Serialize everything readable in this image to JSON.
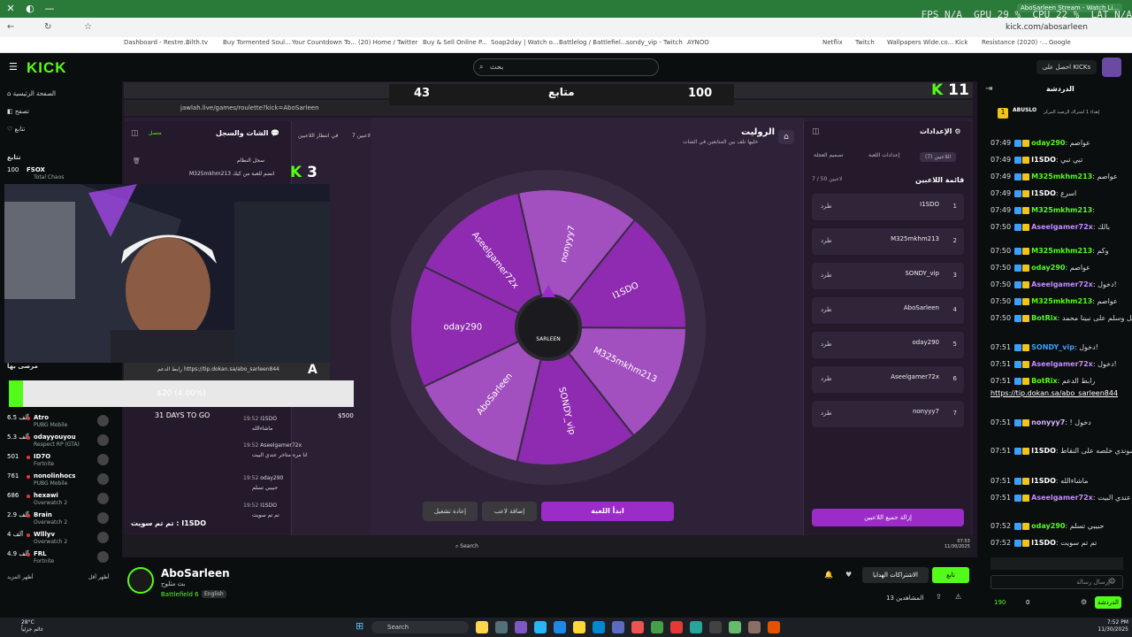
{
  "browser": {
    "url": "kick.com/abosarleen",
    "tab_title": "AboSarleen Stream - Watch Li...",
    "bookmarks": [
      "Dashboard - Restre...",
      "Bilth.tv",
      "Buy Tormented Soul...",
      "Your Countdown To...",
      "(20) Home / Twitter",
      "Buy & Sell Online P...",
      "Soap2day | Watch o...",
      "Battlelog / Battlefiel...",
      "sondy_vip - Twitch",
      "AYNOO",
      "Netflix",
      "Twitch",
      "Wallpapers Wide.co...",
      "Kick",
      "Resistance (2020) -...",
      "Google"
    ]
  },
  "osd": {
    "fps": "FPS  N/A",
    "gpu": "GPU 29 %",
    "cpu": "CPU 22 %",
    "lat": "LAT  N/A"
  },
  "kick": {
    "search_placeholder": "بحث",
    "get_kicks": "احصل على KICKs"
  },
  "sidebar": {
    "nav": [
      "الصفحة الرئيسية",
      "تصفح",
      "تتابع"
    ],
    "following_label": "تتابع",
    "recommended_label": "مرصى بها",
    "show_more": "أظهر المزيد",
    "show_less": "أظهر أقل",
    "channels": [
      {
        "name": "FSOX",
        "viewers": "100",
        "game": "Total Chaos"
      },
      {
        "name": "Atro",
        "viewers": "6.5 آلف",
        "game": "PUBG Mobile"
      },
      {
        "name": "odayyouyou",
        "viewers": "5.3 آلف",
        "game": "Respect RP (GTA)"
      },
      {
        "name": "ID7O",
        "viewers": "501",
        "game": "Fortnite"
      },
      {
        "name": "nonolinhocs",
        "viewers": "761",
        "game": "PUBG Mobile"
      },
      {
        "name": "hexawi",
        "viewers": "686",
        "game": "Overwatch 2"
      },
      {
        "name": "Brain",
        "viewers": "2.9 آلف",
        "game": "Overwatch 2"
      },
      {
        "name": "Wlllyv",
        "viewers": "4 آلف",
        "game": "Overwatch 2"
      },
      {
        "name": "FRL",
        "viewers": "4.9 آلف",
        "game": "Fortnite"
      }
    ]
  },
  "overlay": {
    "score_left": "43",
    "score_label": "متابع",
    "score_right": "100",
    "kick_count": "11",
    "k3": "3"
  },
  "game": {
    "iframe_url": "jawlah.live/games/roulette?kick=AboSarleen",
    "title": "الروليت",
    "subtitle": "خليها تلف بين المتابعين في الشات",
    "waiting": "في انتظار اللاعبين",
    "players_count": "7 لاعبين",
    "settings_title": "الإعدادات",
    "tabs": [
      "اللاعبين (7)",
      "إعدادات اللعبة",
      "تصميم العجلة"
    ],
    "list_title": "قائمة اللاعبين",
    "list_count": "7 / 50 لاعبين",
    "players": [
      {
        "n": "1",
        "name": "I1SDO"
      },
      {
        "n": "2",
        "name": "M325mkhm213"
      },
      {
        "n": "3",
        "name": "SONDY_vip"
      },
      {
        "n": "4",
        "name": "AboSarleen"
      },
      {
        "n": "5",
        "name": "oday290"
      },
      {
        "n": "6",
        "name": "Aseelgamer72x"
      },
      {
        "n": "7",
        "name": "nonyyy7"
      }
    ],
    "kick_label": "طرد",
    "wheel": [
      "Aseelgamer72x",
      "nonyyy7",
      "I1SDO",
      "M325mkhm213",
      "SONDY_vip",
      "AboSarleen",
      "oday290"
    ],
    "wheel_center": "SARLEEN",
    "start": "ابدأ اللعبة",
    "add": "إضافة لاعب",
    "reset": "إعادة تشغيل",
    "remove_all": "إزالة جميع اللاعبين",
    "chat_title": "الشات والسجل",
    "connected": "متصل",
    "system_log": "سجل النظام",
    "join_msg": "M325mkhm213 انضم للعبة من كيك",
    "time": "07:53",
    "date": "11/30/2025"
  },
  "goal": {
    "text": "$20 (4.00%)",
    "days": "31 DAYS TO GO",
    "amount": "$500"
  },
  "donate_url": "رابط الدعم https://tip.dokan.sa/abo_sarleen844",
  "cam_msgs": [
    {
      "user": "I1SDO",
      "text": "ماشاءالله",
      "time": "19:52"
    },
    {
      "user": "Aseelgamer72x",
      "text": "انا مره متاخر عندي البيت",
      "time": "19:52"
    },
    {
      "user": "oday290",
      "text": "حبيبي تسلم",
      "time": "19:52"
    },
    {
      "user": "I1SDO",
      "text": "تم تم سويت",
      "time": "19:52"
    }
  ],
  "cam_bottom": "تم تم سويت : I1SDO",
  "chat": {
    "title": "الدردشة",
    "top_user": "ABUSLO",
    "top_note": "إهداء 1 اشتراك الرصيد المركز",
    "messages": [
      {
        "time": "07:49",
        "user": "oday290",
        "text": "عواصم",
        "color": "#53fc18"
      },
      {
        "time": "07:49",
        "user": "I1SDO",
        "text": "تبي تبي",
        "color": "#ffffff"
      },
      {
        "time": "07:49",
        "user": "M325mkhm213",
        "text": "عواصم",
        "color": "#53fc18"
      },
      {
        "time": "07:49",
        "user": "I1SDO",
        "text": "اسرع",
        "color": "#ffffff"
      },
      {
        "time": "07:49",
        "user": "M325mkhm213",
        "text": "",
        "color": "#53fc18"
      },
      {
        "time": "07:50",
        "user": "Aseelgamer72x",
        "text": "بالك",
        "color": "#c58bff"
      },
      {
        "time": "07:50",
        "user": "M325mkhm213",
        "text": "وكم",
        "color": "#53fc18"
      },
      {
        "time": "07:50",
        "user": "oday290",
        "text": "عواصم",
        "color": "#53fc18"
      },
      {
        "time": "07:50",
        "user": "Aseelgamer72x",
        "text": "دخول!",
        "color": "#c58bff"
      },
      {
        "time": "07:50",
        "user": "M325mkhm213",
        "text": "عواصم",
        "color": "#53fc18"
      },
      {
        "time": "07:50",
        "user": "BotRix",
        "text": "اللهم صل وسلم على نبينا محمد",
        "color": "#53fc18"
      },
      {
        "time": "07:51",
        "user": "SONDY_vip",
        "text": "دخول!",
        "color": "#3ba0ff"
      },
      {
        "time": "07:51",
        "user": "Aseelgamer72x",
        "text": "دخول!",
        "color": "#c58bff"
      },
      {
        "time": "07:51",
        "user": "BotRix",
        "text": "رابط الدعم",
        "color": "#53fc18"
      },
      {
        "time": "07:51",
        "user": "nonyyy7",
        "text": "! دخول",
        "color": "#d8b4ff"
      },
      {
        "time": "07:51",
        "user": "I1SDO",
        "text": "سوندي خلصه على النقاط",
        "color": "#ffffff"
      },
      {
        "time": "07:51",
        "user": "I1SDO",
        "text": "ماشاءالله",
        "color": "#ffffff"
      },
      {
        "time": "07:51",
        "user": "Aseelgamer72x",
        "text": "انا مره متاخر عندي البيت",
        "color": "#c58bff"
      },
      {
        "time": "07:52",
        "user": "oday290",
        "text": "حبيبي تسلم",
        "color": "#53fc18"
      },
      {
        "time": "07:52",
        "user": "I1SDO",
        "text": "تم تم سويت",
        "color": "#ffffff"
      }
    ],
    "link": "https://tip.dokan.sa/abo_sarleen844",
    "input_placeholder": "إرسال رسالة",
    "send": "الدردشة",
    "points": "190",
    "zero": "0"
  },
  "streamer": {
    "name": "AboSarleen",
    "title": "بث مثلوح",
    "category": "Battlefield 6",
    "lang": "English",
    "follow": "تابع",
    "subscribe": "الاشتراكات الهدايا",
    "viewers": "13 المشاهدين"
  },
  "taskbar": {
    "search": "Search",
    "weather_temp": "28°C",
    "weather_desc": "غائم جزئياً",
    "time": "7:52 PM",
    "date": "11/30/2025"
  }
}
